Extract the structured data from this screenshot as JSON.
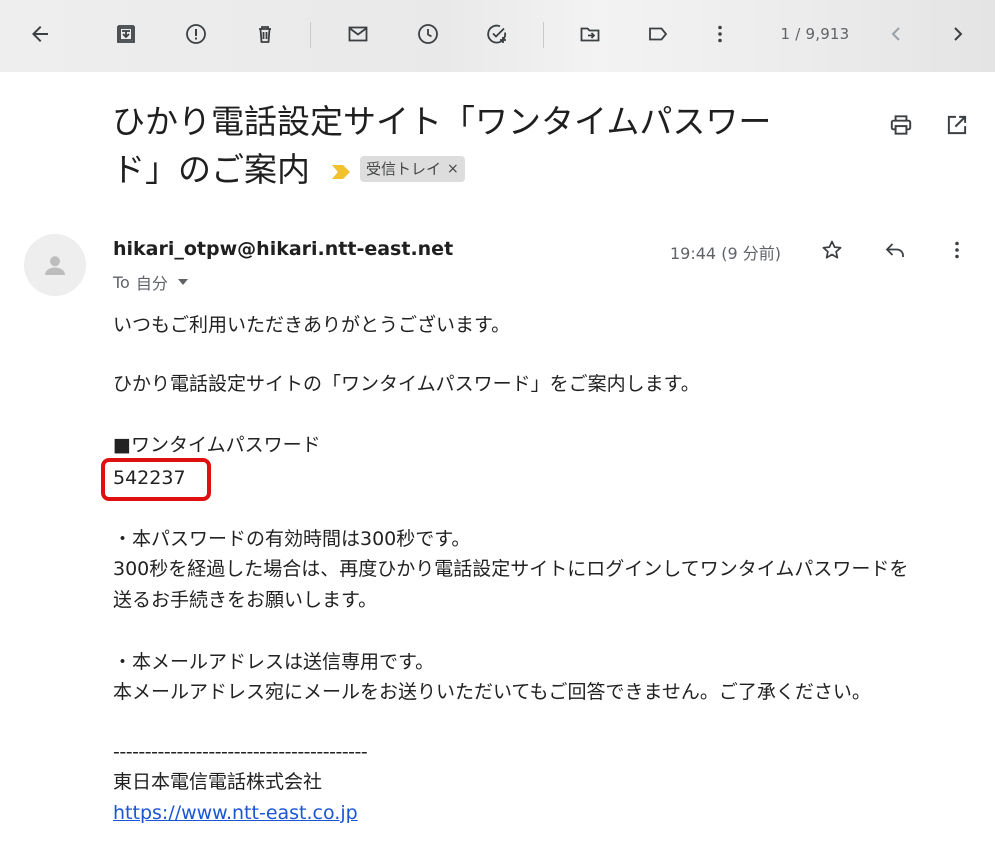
{
  "toolbar": {
    "buttons": [
      {
        "name": "back",
        "icon": "arrow-left-icon"
      },
      {
        "name": "archive",
        "icon": "archive-icon"
      },
      {
        "name": "report-spam",
        "icon": "report-icon"
      },
      {
        "name": "delete",
        "icon": "trash-icon"
      },
      {
        "name": "mark-unread",
        "icon": "mail-icon"
      },
      {
        "name": "snooze",
        "icon": "clock-icon"
      },
      {
        "name": "add-task",
        "icon": "add-task-icon"
      },
      {
        "name": "move-to",
        "icon": "folder-move-icon"
      },
      {
        "name": "labels",
        "icon": "label-icon"
      },
      {
        "name": "more",
        "icon": "more-vert-icon"
      }
    ],
    "pager": "1 / 9,913"
  },
  "subject": {
    "line1": "ひかり電話設定サイト「ワンタイムパスワー",
    "line2": "ド」のご案内",
    "label": "受信トレイ",
    "label_remove": "×"
  },
  "sender": {
    "email": "hikari_otpw@hikari.ntt-east.net",
    "to_prefix": "To",
    "to_name": "自分",
    "time": "19:44 (9 分前)"
  },
  "body": {
    "greeting": "いつもご利用いただきありがとうございます。",
    "intro": "ひかり電話設定サイトの「ワンタイムパスワード」をご案内します。",
    "otp_heading": "■ワンタイムパスワード",
    "otp_value": "542237",
    "note1_line1": "・本パスワードの有効時間は300秒です。",
    "note1_line2": "300秒を経過した場合は、再度ひかり電話設定サイトにログインしてワンタイムパスワードを",
    "note1_line3": "送るお手続きをお願いします。",
    "note2_line1": "・本メールアドレスは送信専用です。",
    "note2_line2": "本メールアドレス宛にメールをお送りいただいてもご回答できません。ご了承ください。",
    "divider": "----------------------------------------",
    "company": "東日本電信電話株式会社",
    "url": "https://www.ntt-east.co.jp"
  },
  "colors": {
    "highlight_box": "#e01010",
    "link": "#1a55d6",
    "important_marker": "#f2c12e"
  }
}
